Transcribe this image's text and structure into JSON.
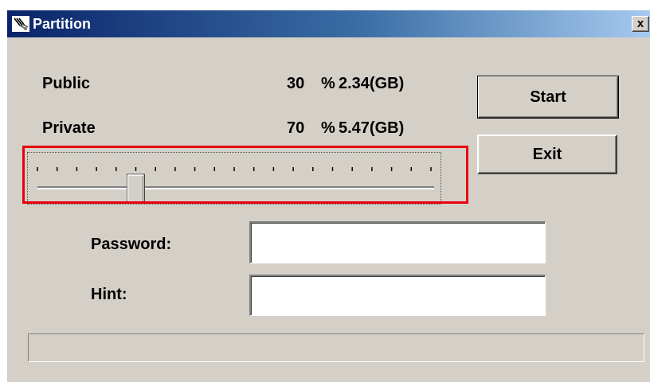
{
  "window": {
    "title": "Partition",
    "close_label": "x"
  },
  "partition": {
    "public": {
      "label": "Public",
      "percent": "30",
      "percent_sign": "%",
      "size": "2.34(GB)"
    },
    "private": {
      "label": "Private",
      "percent": "70",
      "percent_sign": "%",
      "size": "5.47(GB)"
    }
  },
  "slider": {
    "value_fraction": 0.25,
    "tick_count": 21
  },
  "buttons": {
    "start_label": "Start",
    "exit_label": "Exit"
  },
  "form": {
    "password_label": "Password:",
    "password_value": "",
    "hint_label": "Hint:",
    "hint_value": ""
  },
  "status": {
    "text": ""
  },
  "colors": {
    "highlight": "#e8000e",
    "title_bar_start": "#0a246a",
    "face": "#d4d0c8"
  }
}
